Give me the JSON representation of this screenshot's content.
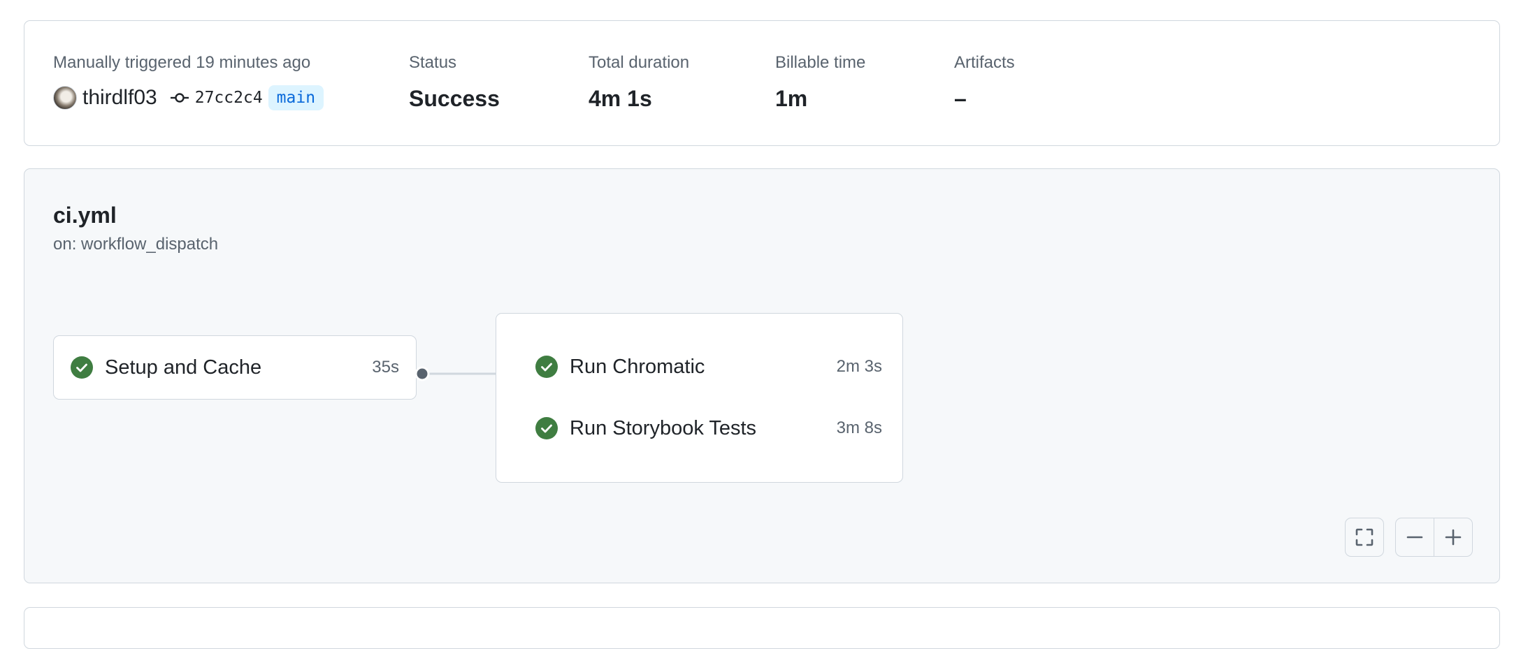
{
  "summary": {
    "trigger_label": "Manually triggered 19 minutes ago",
    "actor": "thirdlf03",
    "commit_sha": "27cc2c4",
    "branch": "main",
    "status_label": "Status",
    "status_value": "Success",
    "total_duration_label": "Total duration",
    "total_duration_value": "4m 1s",
    "billable_time_label": "Billable time",
    "billable_time_value": "1m",
    "artifacts_label": "Artifacts",
    "artifacts_value": "–"
  },
  "workflow": {
    "file": "ci.yml",
    "trigger": "on: workflow_dispatch",
    "jobs": [
      {
        "name": "Setup and Cache",
        "duration": "35s",
        "status": "success"
      },
      {
        "name": "Run Chromatic",
        "duration": "2m 3s",
        "status": "success"
      },
      {
        "name": "Run Storybook Tests",
        "duration": "3m 8s",
        "status": "success"
      }
    ],
    "controls": {
      "fullscreen_icon": "fullscreen-icon",
      "zoom_out_icon": "minus-icon",
      "zoom_in_icon": "plus-icon"
    }
  },
  "colors": {
    "success": "#1a7f37",
    "success_icon_bg": "#3f7d41",
    "border": "#d0d7de",
    "muted_text": "#59636e",
    "branch_text": "#0969da",
    "branch_bg": "#ddf4ff",
    "graph_bg": "#f6f8fa"
  }
}
